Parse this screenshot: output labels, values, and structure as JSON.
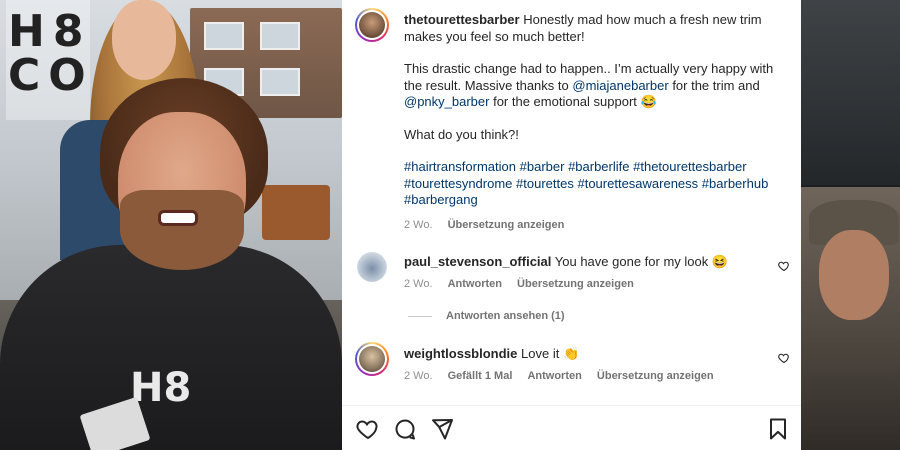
{
  "post": {
    "author": "thetourettesbarber",
    "caption_lines": [
      "Honestly mad how much a fresh new trim makes you feel so much better!",
      "This drastic change had to happen.. I’m actually very happy with the result. Massive thanks to",
      "@miajanebarber",
      "for the trim and",
      "@pnky_barber",
      "for the emotional support 😂",
      "What do you think?!"
    ],
    "hashtags": [
      "#hairtransformation",
      "#barber",
      "#barberlife",
      "#thetourettesbarber",
      "#tourettesyndrome",
      "#tourettes",
      "#tourettesawareness",
      "#barberhub",
      "#barbergang"
    ],
    "age": "2 Wo.",
    "translate_label": "Übersetzung anzeigen"
  },
  "comments": [
    {
      "username": "paul_stevenson_official",
      "text": "You have gone for my look 😆",
      "age": "2 Wo.",
      "reply_label": "Antworten",
      "translate_label": "Übersetzung anzeigen",
      "view_replies_label": "Antworten ansehen (1)"
    },
    {
      "username": "weightlossblondie",
      "text": "Love it 👏",
      "age": "2 Wo.",
      "likes_label": "Gefällt 1 Mal",
      "reply_label": "Antworten",
      "translate_label": "Übersetzung anzeigen"
    }
  ],
  "media": {
    "window_glyphs": "H8\nCO",
    "cape_logo": "H8"
  },
  "icons": {
    "like": "heart-icon",
    "comment": "comment-icon",
    "share": "share-icon",
    "save": "bookmark-icon",
    "comment_like": "small-heart-icon"
  },
  "colors": {
    "text": "#262626",
    "mention": "#00376b",
    "meta": "#8e8e8e",
    "story_ring": [
      "#feda75",
      "#fa7e1e",
      "#d62976",
      "#962fbf",
      "#4f5bd5"
    ]
  }
}
